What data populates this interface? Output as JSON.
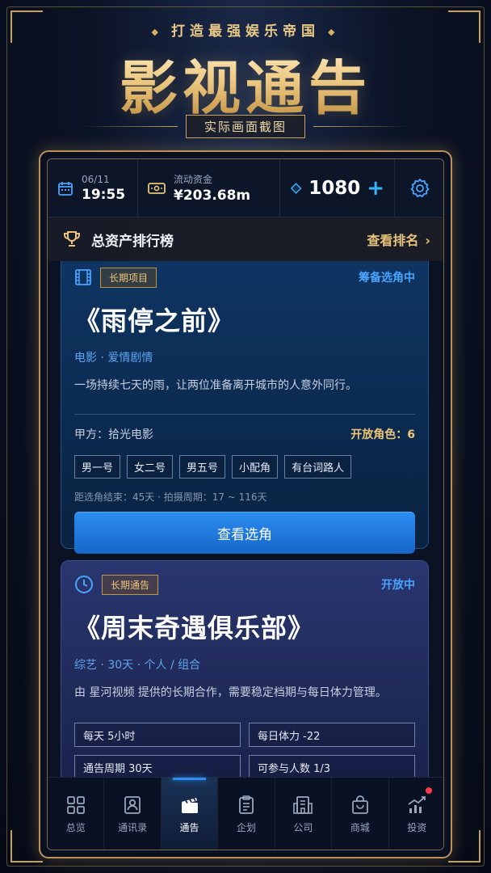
{
  "banner": {
    "tagline": "打造最强娱乐帝国",
    "title": "影视通告",
    "subtitle": "实际画面截图"
  },
  "statusbar": {
    "date": "06/11",
    "time": "19:55",
    "funds_label": "流动资金",
    "funds_value": "¥203.68m",
    "gems": "1080",
    "gems_plus": "+"
  },
  "leaderboard": {
    "title": "总资产排行榜",
    "link": "查看排名"
  },
  "cards": [
    {
      "icon": "film-icon",
      "tag": "长期项目",
      "status": "筹备选角中",
      "title": "《雨停之前》",
      "genre": "电影 · 爱情剧情",
      "desc": "一场持续七天的雨，让两位准备离开城市的人意外同行。",
      "client": "甲方：拾光电影",
      "open_roles": "开放角色：6",
      "roles": [
        "男一号",
        "女二号",
        "男五号",
        "小配角",
        "有台词路人"
      ],
      "meta": "距选角结束：45天 · 拍摄周期：17 ~ 116天",
      "button": "查看选角"
    },
    {
      "icon": "clock-icon",
      "tag": "长期通告",
      "status": "开放中",
      "title": "《周末奇遇俱乐部》",
      "genre": "综艺 · 30天 · 个人 / 组合",
      "desc": "由 星河视频 提供的长期合作，需要稳定档期与每日体力管理。",
      "details": [
        "每天 5小时",
        "每日体力 -22",
        "通告周期 30天",
        "可参与人数 1/3"
      ]
    }
  ],
  "nav": [
    {
      "label": "总览",
      "icon": "overview-icon",
      "active": false
    },
    {
      "label": "通讯录",
      "icon": "contacts-icon",
      "active": false
    },
    {
      "label": "通告",
      "icon": "clapperboard-icon",
      "active": true
    },
    {
      "label": "企划",
      "icon": "clipboard-icon",
      "active": false
    },
    {
      "label": "公司",
      "icon": "building-icon",
      "active": false
    },
    {
      "label": "商城",
      "icon": "bag-icon",
      "active": false
    },
    {
      "label": "投资",
      "icon": "chart-icon",
      "active": false
    }
  ],
  "colors": {
    "gold": "#c9a25a",
    "accent_blue": "#2b8df0",
    "notification_red": "#ff3b4a"
  }
}
